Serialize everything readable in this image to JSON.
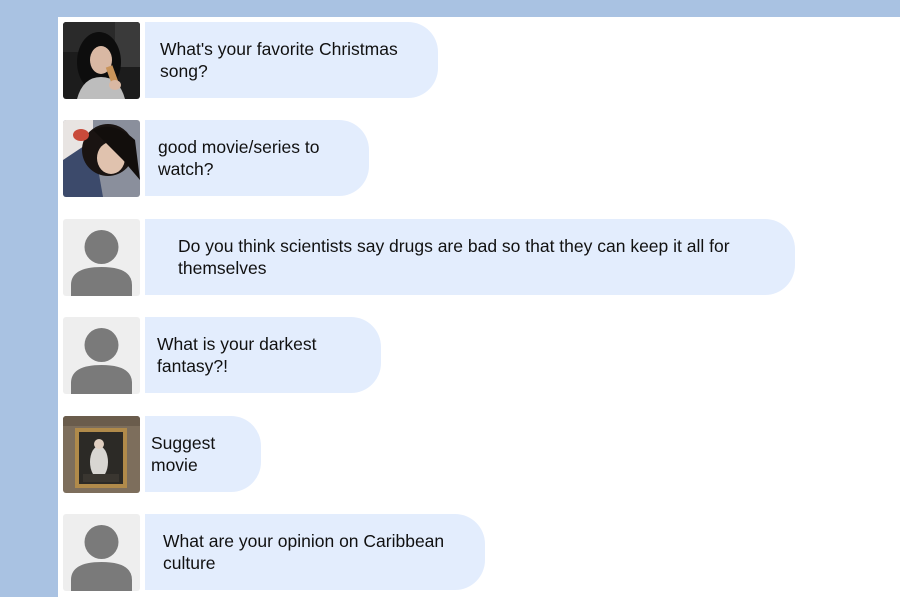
{
  "messages": [
    {
      "text": "What's your favorite Christmas song?",
      "avatar": "photo-woman-icecream"
    },
    {
      "text": "good movie/series to watch?",
      "avatar": "photo-woman-selfie"
    },
    {
      "text": "Do you think scientists say drugs are bad so that they can keep it all for themselves",
      "avatar": "default-avatar-icon"
    },
    {
      "text": "What is your darkest fantasy?!",
      "avatar": "default-avatar-icon"
    },
    {
      "text": "Suggest movie",
      "avatar": "photo-painting"
    },
    {
      "text": "What are your opinion on Caribbean culture",
      "avatar": "default-avatar-icon"
    }
  ],
  "colors": {
    "background": "#a9c2e2",
    "panel": "#ffffff",
    "bubble": "#e3edfd",
    "default_avatar_bg": "#eeeeee",
    "default_avatar_fg": "#7a7a7a"
  }
}
